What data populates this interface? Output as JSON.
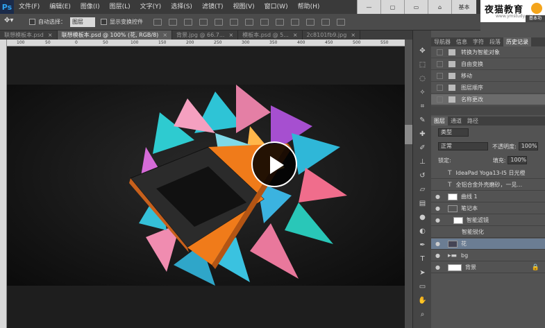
{
  "menubar": {
    "logo": "Ps",
    "items": [
      "文件(F)",
      "编辑(E)",
      "图像(I)",
      "图层(L)",
      "文字(Y)",
      "选择(S)",
      "滤镜(T)",
      "视图(V)",
      "窗口(W)",
      "帮助(H)"
    ],
    "workspace_buttons": [
      "基本"
    ]
  },
  "brand": {
    "title": "夜猫教育",
    "subtitle": "www.ymstudy.cn",
    "workspace": "基本功"
  },
  "options": {
    "auto_select_label": "自动选择：",
    "auto_select_value": "图层",
    "show_transform_label": "显示变换控件"
  },
  "tabs": [
    {
      "label": "联想模板本.psd",
      "active": false
    },
    {
      "label": "联想模板本.psd @ 100% (花, RGB/8)",
      "active": true
    },
    {
      "label": "背景.jpg @ 66.7...",
      "active": false
    },
    {
      "label": "模板本.psd @ 5...",
      "active": false
    },
    {
      "label": "2c8101fb9.jpg",
      "active": false
    }
  ],
  "ruler_top_ticks": [
    "100",
    "50",
    "0",
    "50",
    "100",
    "150",
    "200",
    "250",
    "300",
    "350",
    "400",
    "450",
    "500",
    "550"
  ],
  "history": {
    "tabs": [
      "导航器",
      "信息",
      "字符",
      "段落",
      "历史记录"
    ],
    "items": [
      "转换为智能对象",
      "自由变换",
      "移动",
      "图层顺序",
      "名称更改"
    ]
  },
  "layers": {
    "tabs": [
      "图层",
      "通道",
      "路径"
    ],
    "kind_filter": "类型",
    "blend_mode": "正常",
    "opacity_label": "不透明度:",
    "opacity_value": "100%",
    "lock_label": "锁定:",
    "fill_label": "填充:",
    "fill_value": "100%",
    "rows": [
      {
        "name": "IdeaPad Yoga13-I5 日光橙",
        "type": "text"
      },
      {
        "name": "全铝合金外壳磨砂，一见...",
        "type": "text"
      },
      {
        "name": "曲线 1",
        "type": "adjust"
      },
      {
        "name": "笔记本",
        "type": "smart"
      },
      {
        "name": "智能滤镜",
        "type": "filter"
      },
      {
        "name": "智能锐化",
        "type": "filter-item"
      },
      {
        "name": "花",
        "type": "smart"
      },
      {
        "name": "bg",
        "type": "group"
      },
      {
        "name": "背景",
        "type": "bg"
      }
    ]
  },
  "colors": {
    "laptop_orange": "#f07b1a",
    "selection_blue": "#6b7d93"
  }
}
